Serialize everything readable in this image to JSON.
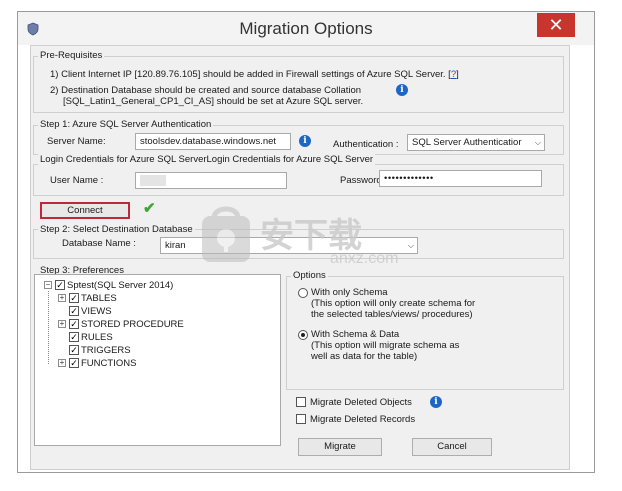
{
  "window": {
    "title": "Migration Options",
    "close_glyph": "✕",
    "icon": "shield-icon"
  },
  "prereq": {
    "heading": "Pre-Requisites",
    "item1": "1) Client Internet IP [120.89.76.105] should be added in Firewall settings of Azure SQL Server. [",
    "item1_link": "?",
    "item1_end": "]",
    "item2_line1": "2) Destination Database should be created and source database Collation",
    "item2_line2": "[SQL_Latin1_General_CP1_CI_AS] should be set at Azure SQL server."
  },
  "step1": {
    "heading": "Step 1: Azure SQL Server Authentication",
    "server_label": "Server Name:",
    "server_value": "stoolsdev.database.windows.net",
    "auth_label": "Authentication :",
    "auth_value": "SQL Server Authenticatior",
    "creds_heading": "Login Credentials for Azure SQL ServerLogin Credentials for Azure SQL Server",
    "user_label": "User Name :",
    "user_value": "",
    "password_label": "Password :",
    "password_value": "•••••••••••••"
  },
  "connect": {
    "label": "Connect",
    "status_glyph": "✔"
  },
  "step2": {
    "heading": "Step 2: Select Destination Database",
    "db_label": "Database Name :",
    "db_value": "kiran"
  },
  "step3": {
    "heading": "Step 3: Preferences",
    "tree": {
      "root": "Sptest(SQL Server 2014)",
      "children": [
        "TABLES",
        "VIEWS",
        "STORED PROCEDURE",
        "RULES",
        "TRIGGERS",
        "FUNCTIONS"
      ]
    },
    "options_heading": "Options",
    "option1_label": "With only Schema",
    "option1_desc1": "(This option will only create schema for",
    "option1_desc2": "the  selected tables/views/ procedures)",
    "option2_label": "With Schema & Data",
    "option2_desc1": "(This option will migrate schema as",
    "option2_desc2": "well as data for the table)",
    "selected_option": "With Schema & Data",
    "migrate_deleted_objects": "Migrate Deleted Objects",
    "migrate_deleted_records": "Migrate Deleted Records"
  },
  "buttons": {
    "migrate": "Migrate",
    "cancel": "Cancel"
  },
  "watermark": {
    "cn": "安下载",
    "latin": "anxz.com"
  },
  "colors": {
    "close_red": "#c7352d",
    "connect_border": "#c0283a",
    "info_blue": "#1e66c5",
    "check_green": "#3fa535"
  }
}
